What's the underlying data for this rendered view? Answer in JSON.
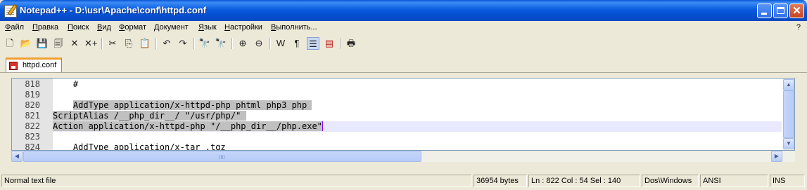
{
  "window": {
    "title": "Notepad++ - D:\\usr\\Apache\\conf\\httpd.conf",
    "app_icon": "notepad-pencil-icon",
    "controls": {
      "minimize": "minimize-icon",
      "maximize": "maximize-icon",
      "close": "✕"
    }
  },
  "menu": {
    "items": [
      {
        "first": "Ф",
        "rest": "айл"
      },
      {
        "first": "П",
        "rest": "равка"
      },
      {
        "first": "П",
        "rest": "оиск"
      },
      {
        "first": "В",
        "rest": "ид"
      },
      {
        "first": "Ф",
        "rest": "ормат"
      },
      {
        "first": "Д",
        "rest": "окумент"
      },
      {
        "first": "Я",
        "rest": "зык"
      },
      {
        "first": "Н",
        "rest": "астройки"
      },
      {
        "first": "В",
        "rest": "ыполнить..."
      }
    ],
    "help": "?"
  },
  "toolbar": {
    "icons": [
      {
        "name": "new-file-icon",
        "glyph": "🗋"
      },
      {
        "name": "open-file-icon",
        "glyph": "📂"
      },
      {
        "name": "save-icon",
        "glyph": "💾"
      },
      {
        "name": "save-all-icon",
        "glyph": "🗐"
      },
      {
        "name": "close-file-icon",
        "glyph": "✕"
      },
      {
        "name": "close-all-icon",
        "glyph": "✕+"
      },
      {
        "name": "cut-icon",
        "glyph": "✂"
      },
      {
        "name": "copy-icon",
        "glyph": "⎘"
      },
      {
        "name": "paste-icon",
        "glyph": "📋"
      },
      {
        "name": "undo-icon",
        "glyph": "↶"
      },
      {
        "name": "redo-icon",
        "glyph": "↷"
      },
      {
        "name": "find-icon",
        "glyph": "🔭"
      },
      {
        "name": "replace-icon",
        "glyph": "🔭"
      },
      {
        "name": "zoom-in-icon",
        "glyph": "⊕"
      },
      {
        "name": "zoom-out-icon",
        "glyph": "⊖"
      },
      {
        "name": "word-wrap-icon",
        "glyph": "W"
      },
      {
        "name": "show-all-chars-icon",
        "glyph": "¶"
      },
      {
        "name": "indent-guide-icon",
        "glyph": "☰"
      },
      {
        "name": "user-lang-icon",
        "glyph": "▤"
      },
      {
        "name": "print-icon",
        "glyph": "🖶"
      }
    ]
  },
  "tab": {
    "label": "httpd.conf",
    "icon": "modified-file-icon"
  },
  "editor": {
    "lines": [
      {
        "num": "818",
        "text": "    #",
        "sel": "",
        "after": ""
      },
      {
        "num": "819",
        "text": "",
        "sel": "",
        "after": ""
      },
      {
        "num": "820",
        "text": "    ",
        "sel": "AddType application/x-httpd-php phtml php3 php ",
        "after": ""
      },
      {
        "num": "821",
        "text": "",
        "sel": "ScriptAlias /__php_dir__/ \"/usr/php/\" ",
        "after": ""
      },
      {
        "num": "822",
        "text": "",
        "sel": "Action application/x-httpd-php \"/__php_dir__/php.exe\"",
        "after": ""
      },
      {
        "num": "823",
        "text": "",
        "sel": "",
        "after": ""
      },
      {
        "num": "824",
        "text": "    AddType application/x-tar .tgz",
        "sel": "",
        "after": ""
      }
    ],
    "current_line": "822"
  },
  "status": {
    "file_type": "Normal text file",
    "size": "36954 bytes",
    "position": "Ln : 822    Col : 54    Sel : 140",
    "eol": "Dos\\Windows",
    "encoding": "ANSI",
    "mode": "INS"
  }
}
